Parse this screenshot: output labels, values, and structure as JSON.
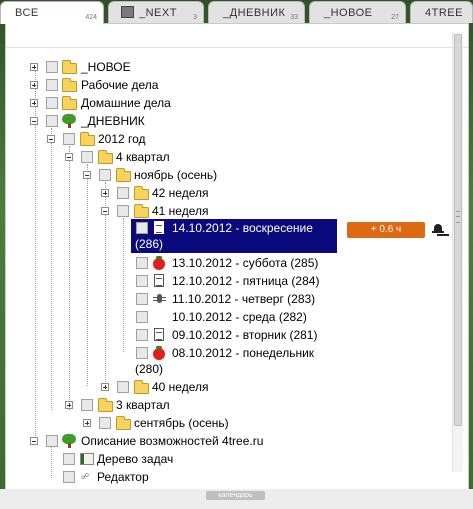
{
  "tabs": [
    {
      "label": "ВСЕ",
      "count": "424",
      "active": true
    },
    {
      "label": "_NEXT",
      "count": "3",
      "icon": "image-icon"
    },
    {
      "label": "_ДНЕВНИК",
      "count": "33"
    },
    {
      "label": "_НОВОЕ",
      "count": "27"
    },
    {
      "label": "4TREE",
      "count": ""
    }
  ],
  "tree": {
    "new": "_НОВОЕ",
    "work": "Рабочие дела",
    "home": "Домашние дела",
    "diary": "_ДНЕВНИК",
    "year": "2012 год",
    "q4": "4 квартал",
    "nov": "ноябрь (осень)",
    "w42": "42 неделя",
    "w41": "41 неделя",
    "d14a": "14.10.2012 - воскресение",
    "d14b": "(286)",
    "d13": "13.10.2012 - суббота (285)",
    "d12": "12.10.2012 - пятница (284)",
    "d11": "11.10.2012 - четверг (283)",
    "d10": "10.10.2012 - среда (282)",
    "d09": "09.10.2012 - вторник (281)",
    "d08a": "08.10.2012 - понедельник",
    "d08b": "(280)",
    "w40": "40 неделя",
    "q3": "3 квартал",
    "sep": "сентябрь (осень)",
    "about": "Описание возможностей 4tree.ru",
    "tasks": "Дерево задач",
    "editor": "Редактор"
  },
  "badge": "+ 0.6 ч",
  "calendar": "календарь",
  "colors": {
    "selection": "#0a0a7d",
    "badge": "#dd6a12",
    "background": "#3f6a33"
  }
}
